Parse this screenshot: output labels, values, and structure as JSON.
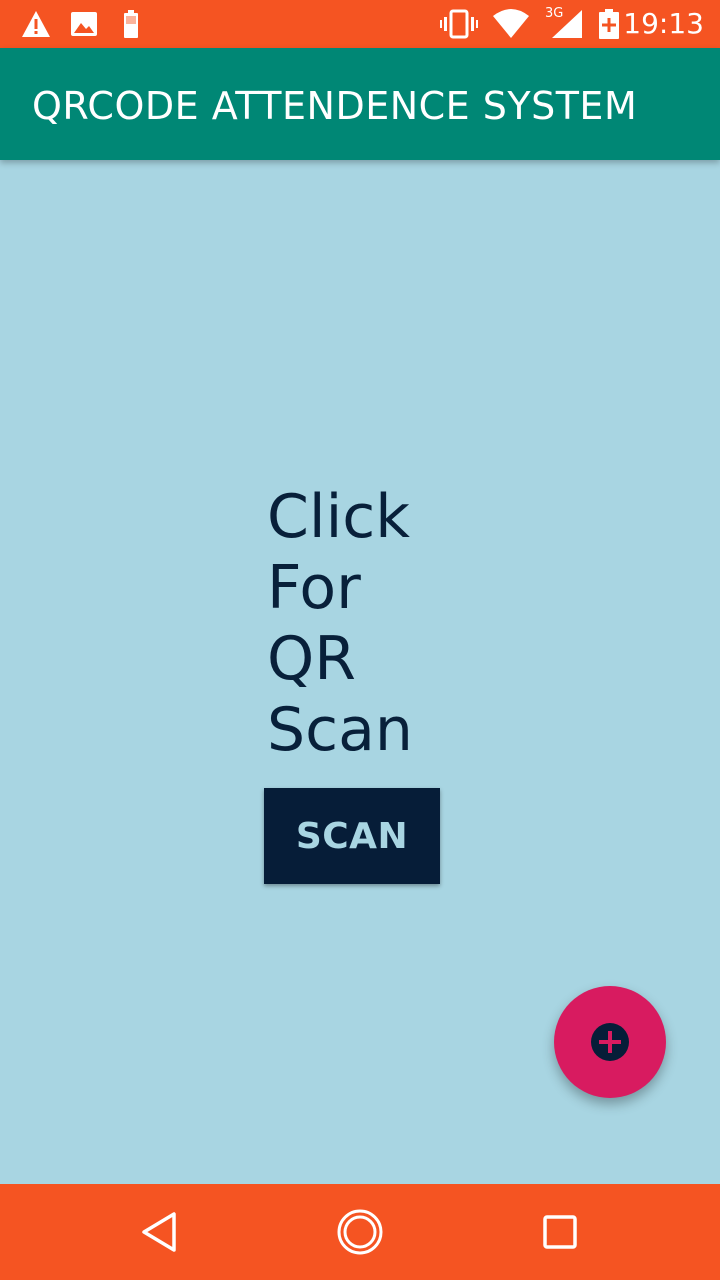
{
  "status_bar": {
    "time": "19:13",
    "network_type": "3G",
    "icons": [
      "warning-icon",
      "image-icon",
      "battery-small-icon",
      "vibrate-icon",
      "wifi-icon",
      "cell-signal-icon",
      "battery-charging-icon"
    ],
    "color": "#f55422"
  },
  "app_bar": {
    "title": "QRCODE ATTENDENCE SYSTEM",
    "color": "#008775"
  },
  "main": {
    "background": "#a8d5e2",
    "prompt_lines": [
      "Click",
      "For",
      "QR",
      "Scan"
    ],
    "scan_button_label": "SCAN",
    "fab_icon": "add-circle-icon",
    "fab_color": "#d81b60"
  },
  "nav_bar": {
    "buttons": [
      "back-icon",
      "home-icon",
      "recents-icon"
    ],
    "color": "#f55422"
  }
}
